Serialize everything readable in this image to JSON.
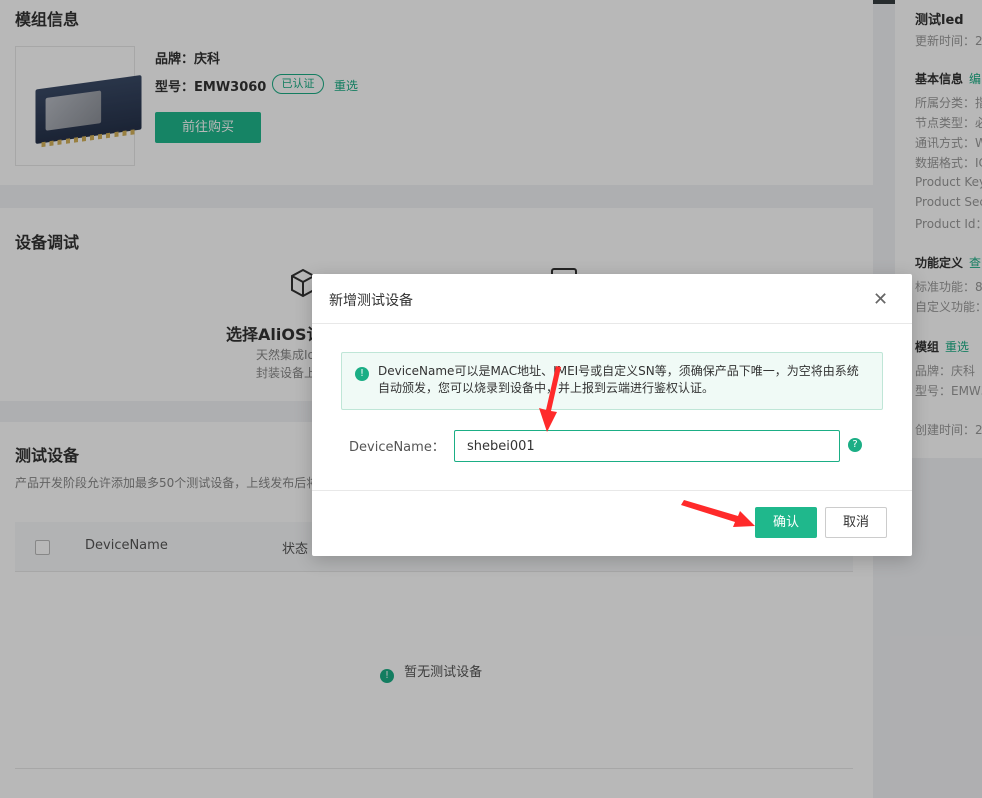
{
  "module_section": {
    "title": "模组信息",
    "brand": "品牌：庆科",
    "model": "型号：EMW3060",
    "certified_badge": "已认证",
    "reselect_link": "重选",
    "buy_button": "前往购买"
  },
  "debug_section": {
    "title": "设备调试",
    "option_title": "选择AliOS认",
    "option_desc_1": "天然集成Io",
    "option_desc_2": "封装设备上"
  },
  "test_devices": {
    "title": "测试设备",
    "subtitle": "产品开发阶段允许添加最多50个测试设备，上线发布后将",
    "columns": [
      "DeviceName",
      "状态"
    ],
    "empty_text": "暂无测试设备"
  },
  "sidebar": {
    "title": "测试led",
    "updated": "更新时间：2",
    "basic_info": "基本信息",
    "basic_edit": "编",
    "category": "所属分类：",
    "category_cut": "指",
    "node_type": "节点类型：",
    "node_type_cut": "必",
    "comm": "通讯方式：",
    "comm_cut": "W",
    "data_format": "数据格式：",
    "data_format_cut": "IC",
    "product_key": "Product Key",
    "product_secret": "Product Sec",
    "product_id": "Product Id：",
    "func_def": "功能定义",
    "func_link": "查",
    "std_func": "标准功能：",
    "std_func_cut": "8",
    "custom_func": "自定义功能：",
    "module": "模组",
    "module_reselect": "重选",
    "module_brand": "品牌：庆科",
    "module_model": "型号：EMW3",
    "created": "创建时间：2"
  },
  "modal": {
    "title": "新增测试设备",
    "notice": "DeviceName可以是MAC地址、IMEI号或自定义SN等，须确保产品下唯一，为空将由系统自动颁发，您可以烧录到设备中，并上报到云端进行鉴权认证。",
    "field_label": "DeviceName：",
    "field_value": "shebei001",
    "confirm": "确认",
    "cancel": "取消"
  },
  "colors": {
    "accent": "#1fb88c",
    "arrow": "#ff2a2a"
  }
}
